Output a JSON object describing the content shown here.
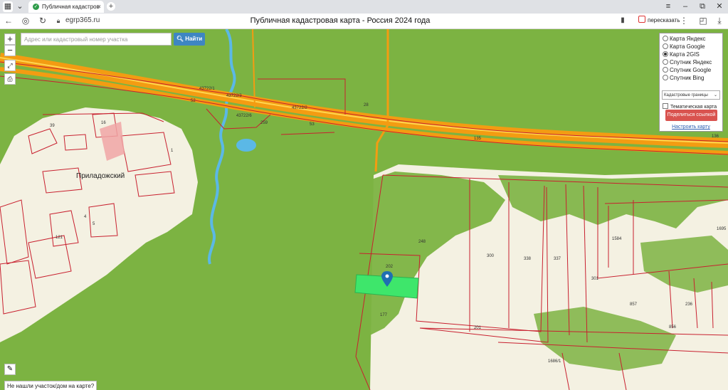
{
  "browser": {
    "tab_title": "Публичная кадастров",
    "url": "egrp365.ru",
    "page_title": "Публичная кадастровая карта - Россия 2024 года",
    "retell_label": "пересказать"
  },
  "map": {
    "search_placeholder": "Адрес или кадастровый номер участка",
    "find_button": "Найти",
    "zoom_in": "+",
    "zoom_out": "−",
    "layers": {
      "options": [
        "Карта Яндекс",
        "Карта Google",
        "Карта 2GIS",
        "Спутник Яндекс",
        "Спутник Google",
        "Спутник Bing"
      ],
      "selected": "Карта 2GIS",
      "cadastre_select": "Кадастровые границы",
      "thematic_label": "Тематическая карта",
      "share_button": "Поделиться ссылкой",
      "configure_link": "Настроить карту"
    },
    "not_found_button": "Не нашли участок/дом на карте?",
    "locality": "Приладожский",
    "road_labels": [
      "43722/1",
      "43722/2",
      "43722/3",
      "43722/6",
      "52",
      "53",
      "135",
      "136"
    ],
    "parcel_labels": [
      "248",
      "300",
      "338",
      "337",
      "202",
      "201",
      "177",
      "1584",
      "1695",
      "857",
      "856",
      "236",
      "301",
      "1686/1",
      "28",
      "259",
      "39",
      "16",
      "5",
      "4",
      "1",
      "121"
    ],
    "colors": {
      "forest": "#7cb342",
      "field": "#f4f1e2",
      "highway": "#f39c12",
      "highlight": "#3ee66b",
      "boundary": "#c8202f",
      "water": "#5bb8e6"
    }
  }
}
